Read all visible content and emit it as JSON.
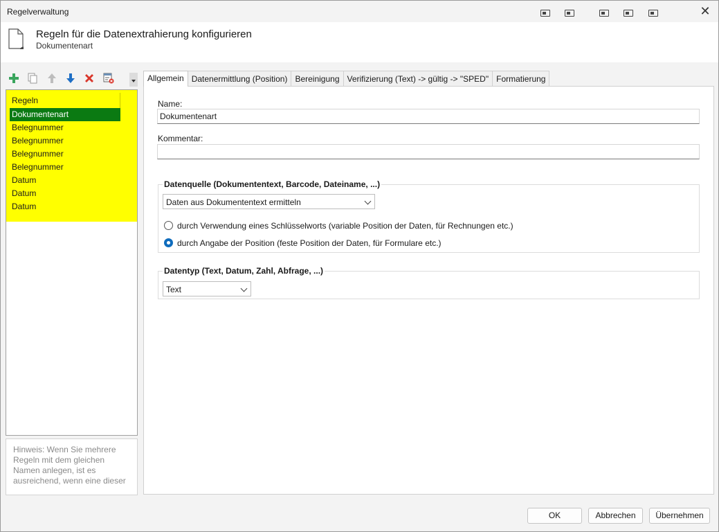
{
  "window": {
    "title": "Regelverwaltung",
    "close_glyph": "✕"
  },
  "header": {
    "title": "Regeln für die Datenextrahierung konfigurieren",
    "subtitle": "Dokumentenart"
  },
  "toolbar": {
    "icons": [
      "add-icon",
      "copy-icon",
      "move-up-icon",
      "move-down-icon",
      "delete-icon",
      "delete-all-icon",
      "dropdown-icon"
    ]
  },
  "rules": {
    "header": "Regeln",
    "items": [
      {
        "label": "Dokumentenart",
        "selected": true
      },
      {
        "label": "Belegnummer",
        "selected": false
      },
      {
        "label": "Belegnummer",
        "selected": false
      },
      {
        "label": "Belegnummer",
        "selected": false
      },
      {
        "label": "Belegnummer",
        "selected": false
      },
      {
        "label": "Datum",
        "selected": false
      },
      {
        "label": "Datum",
        "selected": false
      },
      {
        "label": "Datum",
        "selected": false
      }
    ],
    "highlight_color": "#ffff00",
    "selected_color": "#0b7a12"
  },
  "hint": {
    "lines": [
      "Hinweis: Wenn Sie mehrere",
      "Regeln mit dem gleichen",
      "Namen anlegen, ist es",
      "ausreichend, wenn eine dieser"
    ]
  },
  "tabs": [
    {
      "label": "Allgemein",
      "active": true
    },
    {
      "label": "Datenermittlung (Position)",
      "active": false
    },
    {
      "label": "Bereinigung",
      "active": false
    },
    {
      "label": "Verifizierung (Text) -> gültig -> \"SPED\"",
      "active": false
    },
    {
      "label": "Formatierung",
      "active": false
    }
  ],
  "form": {
    "name_label": "Name:",
    "name_value": "Dokumentenart",
    "comment_label": "Kommentar:",
    "comment_value": "",
    "datasource": {
      "title": "Datenquelle (Dokumententext, Barcode, Dateiname, ...)",
      "selected": "Daten aus Dokumententext ermitteln",
      "radio_keyword": "durch Verwendung eines Schlüsselworts (variable Position der Daten, für Rechnungen etc.)",
      "radio_position": "durch Angabe der Position (feste Position der Daten, für Formulare etc.)",
      "checked": "position"
    },
    "datatype": {
      "title": "Datentyp (Text, Datum, Zahl, Abfrage, ...)",
      "selected": "Text"
    }
  },
  "buttons": {
    "ok": "OK",
    "cancel": "Abbrechen",
    "apply": "Übernehmen"
  },
  "colors": {
    "accent": "#0f6cbd"
  }
}
